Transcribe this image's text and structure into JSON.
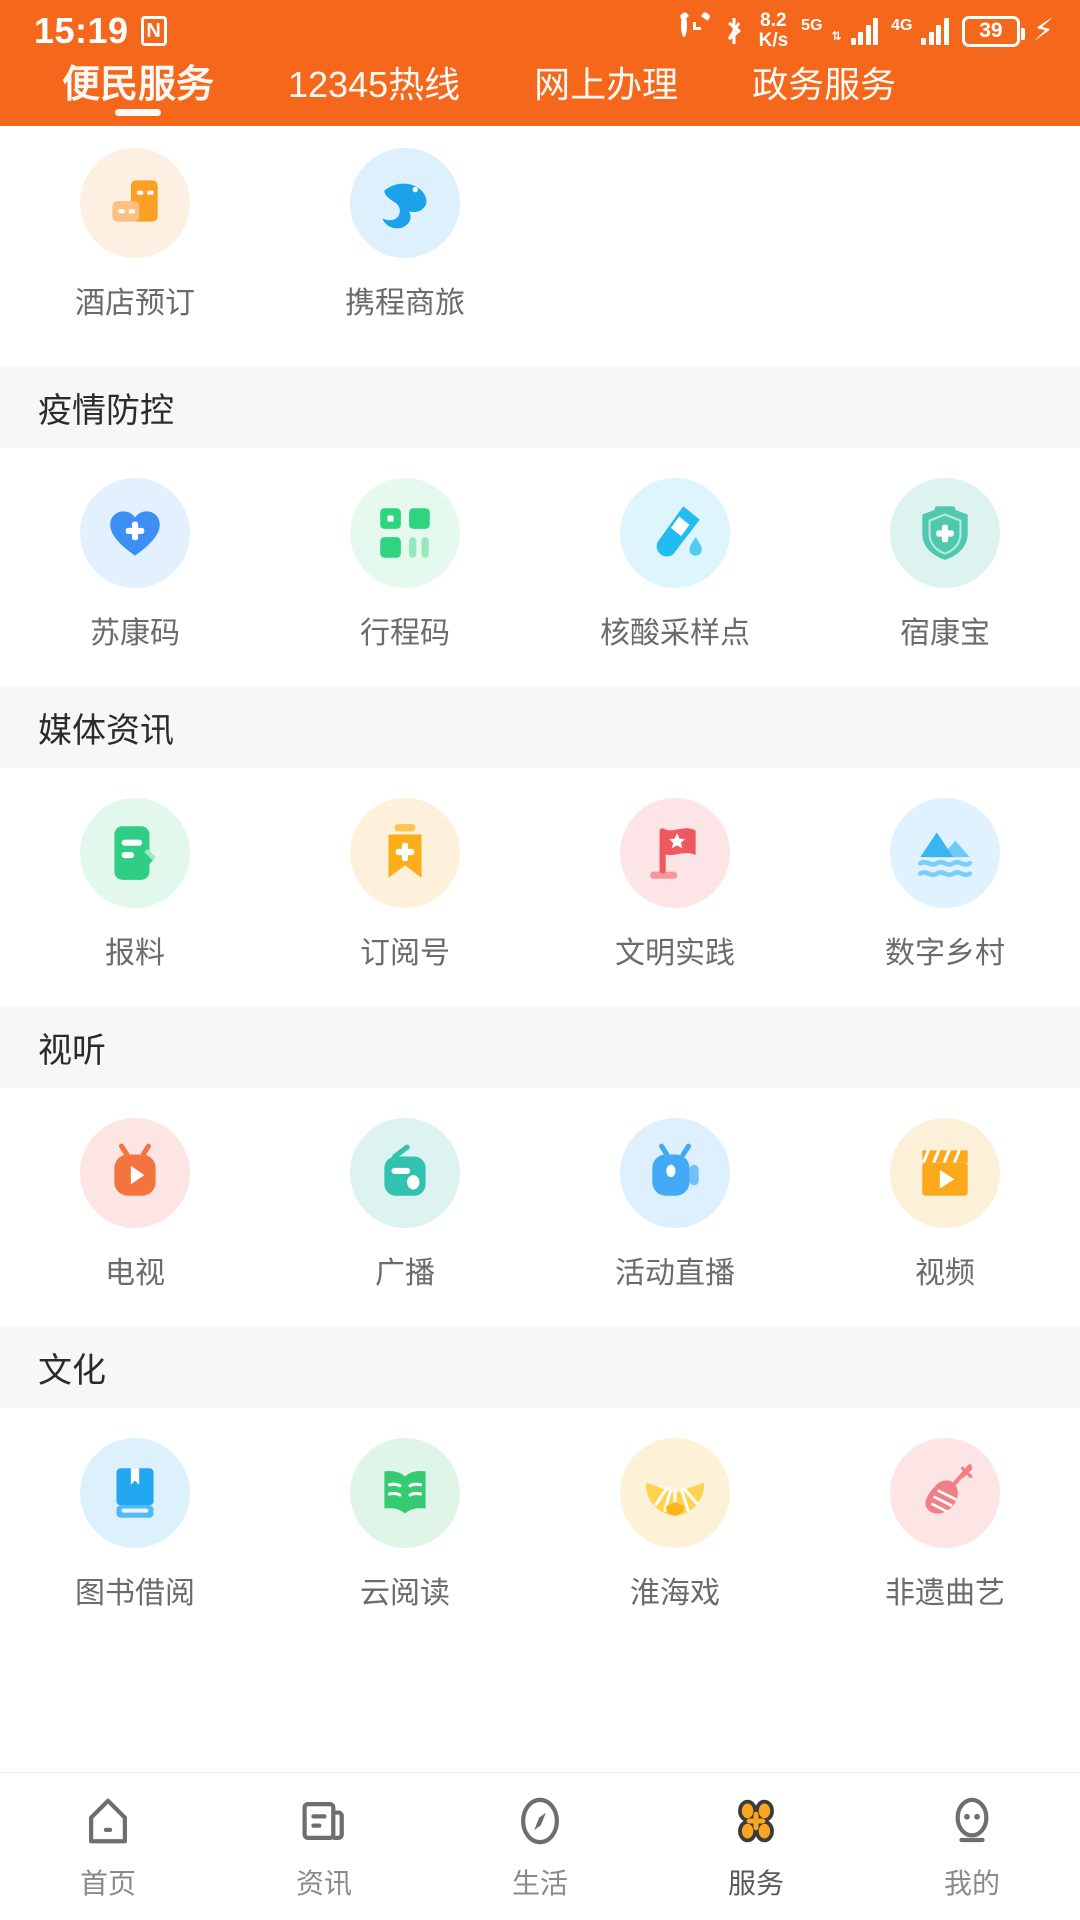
{
  "status_bar": {
    "time": "15:19",
    "nfc_label": "N",
    "net_speed_value": "8.2",
    "net_speed_unit": "K/s",
    "sim1_label": "5G",
    "sim2_label": "4G",
    "battery_level": "39",
    "charging": true,
    "background_color": "#F5681B"
  },
  "top_tabs": {
    "active_index": 0,
    "items": [
      {
        "label": "便民服务"
      },
      {
        "label": "12345热线"
      },
      {
        "label": "网上办理"
      },
      {
        "label": "政务服务"
      }
    ]
  },
  "sections": [
    {
      "title": "",
      "partial": true,
      "items": [
        {
          "label": "酒店预订",
          "icon": "hotel-building-icon",
          "bg": "#FDEFE2",
          "fg": "#FBA023"
        },
        {
          "label": "携程商旅",
          "icon": "dolphin-icon",
          "bg": "#DDF0FC",
          "fg": "#1CA2EA"
        }
      ]
    },
    {
      "title": "疫情防控",
      "partial": false,
      "items": [
        {
          "label": "苏康码",
          "icon": "heart-plus-icon",
          "bg": "#E2F1FD",
          "fg": "#3C8FF5"
        },
        {
          "label": "行程码",
          "icon": "qr-blocks-icon",
          "bg": "#E5F9EE",
          "fg": "#2FD47F"
        },
        {
          "label": "核酸采样点",
          "icon": "test-tube-icon",
          "bg": "#DEF5FD",
          "fg": "#22BDF0"
        },
        {
          "label": "宿康宝",
          "icon": "shield-cross-icon",
          "bg": "#DDF3EF",
          "fg": "#4FC9AE"
        }
      ]
    },
    {
      "title": "媒体资讯",
      "partial": false,
      "items": [
        {
          "label": "报料",
          "icon": "notepad-pencil-icon",
          "bg": "#E2F8EC",
          "fg": "#2ECE84"
        },
        {
          "label": "订阅号",
          "icon": "bookmark-plus-icon",
          "bg": "#FDF1DC",
          "fg": "#FBAE17"
        },
        {
          "label": "文明实践",
          "icon": "flag-star-icon",
          "bg": "#FDE4E6",
          "fg": "#F0585F"
        },
        {
          "label": "数字乡村",
          "icon": "mountain-water-icon",
          "bg": "#DFF2FD",
          "fg": "#39B6F2"
        }
      ]
    },
    {
      "title": "视听",
      "partial": false,
      "items": [
        {
          "label": "电视",
          "icon": "tv-play-icon",
          "bg": "#FDE5E3",
          "fg": "#F4743F"
        },
        {
          "label": "广播",
          "icon": "radio-icon",
          "bg": "#DCF3F0",
          "fg": "#32C3B0"
        },
        {
          "label": "活动直播",
          "icon": "video-camera-icon",
          "bg": "#DEEFFD",
          "fg": "#41A9F5"
        },
        {
          "label": "视频",
          "icon": "clapperboard-icon",
          "bg": "#FDF0D9",
          "fg": "#FBA81A"
        }
      ]
    },
    {
      "title": "文化",
      "partial": false,
      "items": [
        {
          "label": "图书借阅",
          "icon": "book-bookmark-icon",
          "bg": "#DDF1FD",
          "fg": "#22A7F0"
        },
        {
          "label": "云阅读",
          "icon": "open-book-icon",
          "bg": "#DFF5E7",
          "fg": "#36CA72"
        },
        {
          "label": "淮海戏",
          "icon": "folding-fan-icon",
          "bg": "#FDF1D8",
          "fg": "#FBB418"
        },
        {
          "label": "非遗曲艺",
          "icon": "pipa-lute-icon",
          "bg": "#FDE5E6",
          "fg": "#F08086"
        }
      ]
    }
  ],
  "bottom_nav": {
    "active_index": 3,
    "accent_color": "#FBA620",
    "items": [
      {
        "label": "首页",
        "icon": "home-icon"
      },
      {
        "label": "资讯",
        "icon": "news-icon"
      },
      {
        "label": "生活",
        "icon": "compass-icon"
      },
      {
        "label": "服务",
        "icon": "grid-flower-icon"
      },
      {
        "label": "我的",
        "icon": "person-icon"
      }
    ]
  }
}
